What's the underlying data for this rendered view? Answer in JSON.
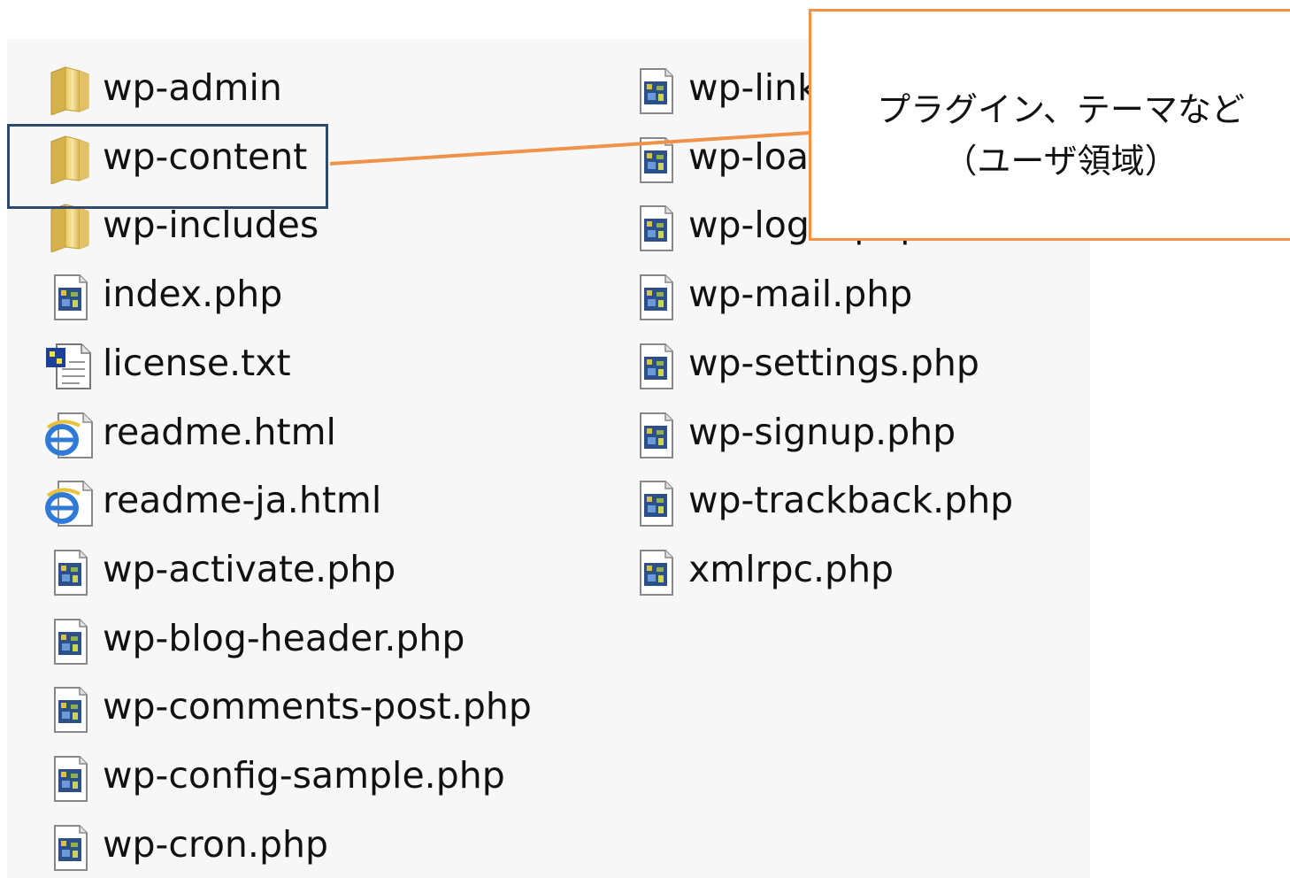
{
  "files_left": [
    {
      "name": "wp-admin",
      "icon": "folder-icon"
    },
    {
      "name": "wp-content",
      "icon": "folder-icon"
    },
    {
      "name": "wp-includes",
      "icon": "folder-icon"
    },
    {
      "name": "index.php",
      "icon": "php-file-icon"
    },
    {
      "name": "license.txt",
      "icon": "text-file-icon"
    },
    {
      "name": "readme.html",
      "icon": "ie-html-file-icon"
    },
    {
      "name": "readme-ja.html",
      "icon": "ie-html-file-icon"
    },
    {
      "name": "wp-activate.php",
      "icon": "php-file-icon"
    },
    {
      "name": "wp-blog-header.php",
      "icon": "php-file-icon"
    },
    {
      "name": "wp-comments-post.php",
      "icon": "php-file-icon"
    },
    {
      "name": "wp-config-sample.php",
      "icon": "php-file-icon"
    },
    {
      "name": "wp-cron.php",
      "icon": "php-file-icon"
    }
  ],
  "files_right": [
    {
      "name": "wp-links-opml.php",
      "icon": "php-file-icon"
    },
    {
      "name": "wp-load.php",
      "icon": "php-file-icon"
    },
    {
      "name": "wp-login.php",
      "icon": "php-file-icon"
    },
    {
      "name": "wp-mail.php",
      "icon": "php-file-icon"
    },
    {
      "name": "wp-settings.php",
      "icon": "php-file-icon"
    },
    {
      "name": "wp-signup.php",
      "icon": "php-file-icon"
    },
    {
      "name": "wp-trackback.php",
      "icon": "php-file-icon"
    },
    {
      "name": "xmlrpc.php",
      "icon": "php-file-icon"
    }
  ],
  "callout": {
    "line1": "プラグイン、テーマなど",
    "line2": "（ユーザ領域）"
  },
  "colors": {
    "highlight_border": "#2c4a6e",
    "callout_border": "#f0924a",
    "connector": "#f0924a"
  }
}
